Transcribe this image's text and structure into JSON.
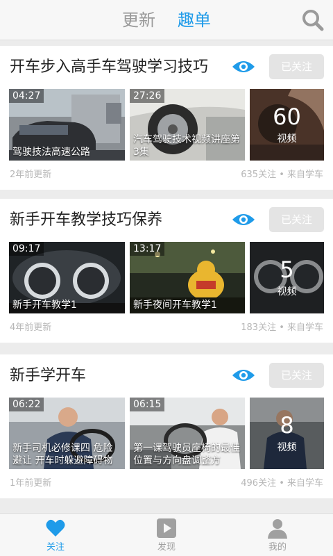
{
  "header": {
    "tabs": [
      "更新",
      "趣单"
    ],
    "active_tab": "趣单",
    "search_icon": "search-icon",
    "accent_color": "#1f9be9"
  },
  "cards": [
    {
      "title": "开车步入高手车驾驶学习技巧",
      "follow_label": "已关注",
      "videos": [
        {
          "duration": "04:27",
          "caption": "驾驶技法高速公路"
        },
        {
          "duration": "27:26",
          "caption": "汽车驾驶技术视频讲座第3集"
        }
      ],
      "more": {
        "count": "60",
        "label": "视频"
      },
      "updated": "2年前更新",
      "stats": "635关注 • 来自学车"
    },
    {
      "title": "新手开车教学技巧保养",
      "follow_label": "已关注",
      "videos": [
        {
          "duration": "09:17",
          "caption": "新手开车教学1"
        },
        {
          "duration": "13:17",
          "caption": "新手夜间开车教学1"
        }
      ],
      "more": {
        "count": "5",
        "label": "视频"
      },
      "updated": "4年前更新",
      "stats": "183关注 • 来自学车"
    },
    {
      "title": "新手学开车",
      "follow_label": "已关注",
      "videos": [
        {
          "duration": "06:22",
          "caption": "新手司机必修课四 危险避让 开车时躲避障碍物"
        },
        {
          "duration": "06:15",
          "caption": "第一课驾驶员座椅的最佳位置与方向盘调整方"
        }
      ],
      "more": {
        "count": "8",
        "label": "视频"
      },
      "updated": "1年前更新",
      "stats": "496关注 • 来自学车"
    }
  ],
  "bottom_nav": [
    {
      "label": "关注",
      "icon": "heart-icon",
      "active": true
    },
    {
      "label": "发现",
      "icon": "play-icon",
      "active": false
    },
    {
      "label": "我的",
      "icon": "user-icon",
      "active": false
    }
  ]
}
